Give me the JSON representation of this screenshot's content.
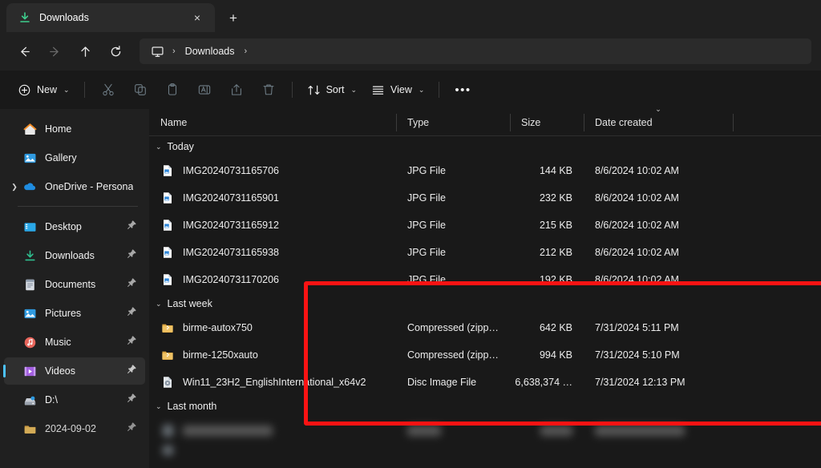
{
  "window": {
    "tab": {
      "title": "Downloads",
      "icon": "download-icon",
      "close_label": "×"
    },
    "new_tab_label": "+"
  },
  "nav": {
    "back": "←",
    "forward": "→",
    "up": "↑",
    "refresh": "↻",
    "breadcrumb": {
      "root_icon": "this-pc-monitor-icon",
      "items": [
        "Downloads"
      ],
      "separator": "›"
    }
  },
  "toolbar": {
    "new_label": "New",
    "chevron": "⌄",
    "cut_label": "Cut",
    "copy_label": "Copy",
    "paste_label": "Paste",
    "rename_label": "Rename",
    "share_label": "Share",
    "delete_label": "Delete",
    "sort_label": "Sort",
    "view_label": "View",
    "more_label": "•••"
  },
  "sidebar": {
    "items": [
      {
        "label": "Home",
        "icon": "home-icon",
        "expandable": false,
        "pinned": false,
        "selected": false
      },
      {
        "label": "Gallery",
        "icon": "gallery-icon",
        "expandable": false,
        "pinned": false,
        "selected": false
      },
      {
        "label": "OneDrive - Persona",
        "icon": "onedrive-cloud-icon",
        "expandable": true,
        "pinned": false,
        "selected": false
      },
      {
        "divider": true
      },
      {
        "label": "Desktop",
        "icon": "desktop-icon",
        "expandable": false,
        "pinned": true,
        "selected": false
      },
      {
        "label": "Downloads",
        "icon": "downloads-icon",
        "expandable": false,
        "pinned": true,
        "selected": false
      },
      {
        "label": "Documents",
        "icon": "documents-icon",
        "expandable": false,
        "pinned": true,
        "selected": false
      },
      {
        "label": "Pictures",
        "icon": "pictures-icon",
        "expandable": false,
        "pinned": true,
        "selected": false
      },
      {
        "label": "Music",
        "icon": "music-icon",
        "expandable": false,
        "pinned": true,
        "selected": false
      },
      {
        "label": "Videos",
        "icon": "videos-icon",
        "expandable": false,
        "pinned": true,
        "selected": true
      },
      {
        "label": "D:\\",
        "icon": "drive-icon",
        "expandable": false,
        "pinned": true,
        "selected": false
      },
      {
        "label": "2024-09-02",
        "icon": "folder-icon",
        "expandable": false,
        "pinned": true,
        "selected": false
      }
    ]
  },
  "columns": {
    "name": "Name",
    "type": "Type",
    "size": "Size",
    "date": "Date created",
    "sort_indicator": "⌄"
  },
  "groups": [
    {
      "label": "Today",
      "chevron": "⌄",
      "rows": [
        {
          "name": "IMG20240731165706",
          "icon": "jpg-file-icon",
          "type": "JPG File",
          "size": "144 KB",
          "date": "8/6/2024 10:02 AM"
        },
        {
          "name": "IMG20240731165901",
          "icon": "jpg-file-icon",
          "type": "JPG File",
          "size": "232 KB",
          "date": "8/6/2024 10:02 AM"
        },
        {
          "name": "IMG20240731165912",
          "icon": "jpg-file-icon",
          "type": "JPG File",
          "size": "215 KB",
          "date": "8/6/2024 10:02 AM"
        },
        {
          "name": "IMG20240731165938",
          "icon": "jpg-file-icon",
          "type": "JPG File",
          "size": "212 KB",
          "date": "8/6/2024 10:02 AM"
        },
        {
          "name": "IMG20240731170206",
          "icon": "jpg-file-icon",
          "type": "JPG File",
          "size": "192 KB",
          "date": "8/6/2024 10:02 AM"
        }
      ]
    },
    {
      "label": "Last week",
      "chevron": "⌄",
      "rows": [
        {
          "name": "birme-autox750",
          "icon": "zip-folder-icon",
          "type": "Compressed (zipp…",
          "size": "642 KB",
          "date": "7/31/2024 5:11 PM"
        },
        {
          "name": "birme-1250xauto",
          "icon": "zip-folder-icon",
          "type": "Compressed (zipp…",
          "size": "994 KB",
          "date": "7/31/2024 5:10 PM"
        },
        {
          "name": "Win11_23H2_EnglishInternational_x64v2",
          "icon": "disc-image-icon",
          "type": "Disc Image File",
          "size": "6,638,374 …",
          "date": "7/31/2024 12:13 PM"
        }
      ]
    },
    {
      "label": "Last month",
      "chevron": "⌄",
      "rows": []
    }
  ],
  "annotation": {
    "shape": "rectangle",
    "color": "#fb1313",
    "targets": "Today group file rows"
  },
  "colors": {
    "accent": "#4cc2ff",
    "annotation_red": "#fb1313",
    "window_bg": "#191919",
    "chrome_bg": "#202020",
    "selected_row": "#2f2f2f"
  }
}
